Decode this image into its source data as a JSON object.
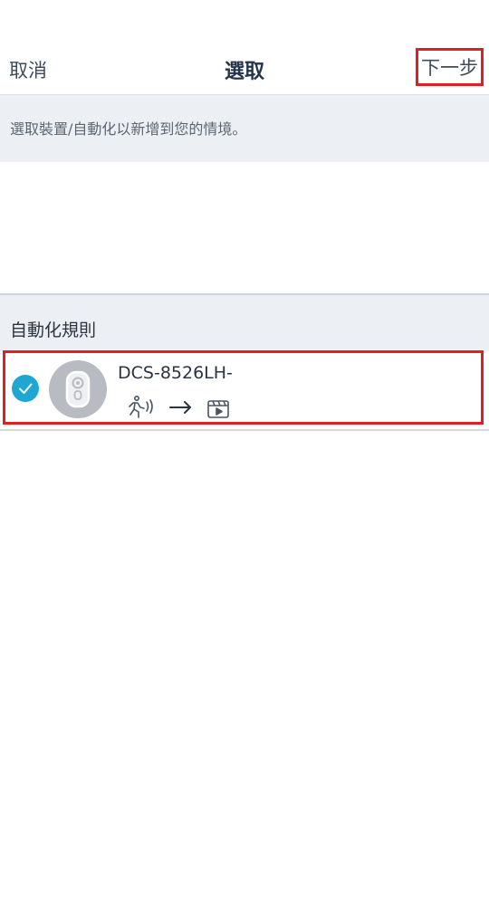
{
  "header": {
    "cancel_label": "取消",
    "title": "選取",
    "next_label": "下一步"
  },
  "banner": {
    "text": "選取裝置/自動化以新增到您的情境。"
  },
  "automation_section": {
    "title": "自動化規則",
    "items": [
      {
        "device_name": "DCS-8526LH-",
        "selected": true,
        "trigger_icon": "motion-detection-icon",
        "action_icon": "video-clip-icon"
      }
    ]
  },
  "colors": {
    "accent": "#1fa7d4",
    "highlight_border": "#e02020",
    "section_bg": "#eceff3"
  }
}
